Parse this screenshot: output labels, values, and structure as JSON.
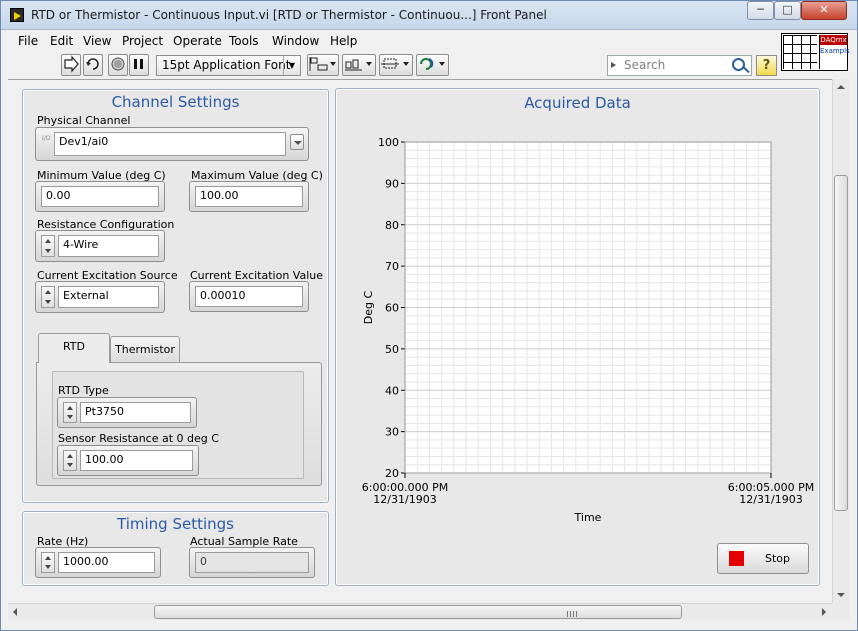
{
  "window": {
    "title": "RTD or Thermistor - Continuous Input.vi [RTD or Thermistor - Continuou...] Front Panel",
    "min_label": "─",
    "max_label": "□",
    "close_label": "✕"
  },
  "menu": [
    "File",
    "Edit",
    "View",
    "Project",
    "Operate",
    "Tools",
    "Window",
    "Help"
  ],
  "toolbar": {
    "font": "15pt Application Font",
    "search_placeholder": "Search",
    "help_label": "?"
  },
  "vi_icon": {
    "line1": "DAQmx",
    "line2": "Exampls"
  },
  "channel_settings": {
    "title": "Channel Settings",
    "physical_channel_label": "Physical Channel",
    "physical_channel_value": "Dev1/ai0",
    "io_glyph": "I/O",
    "min_label": "Minimum Value (deg C)",
    "min_value": "0.00",
    "max_label": "Maximum Value (deg C)",
    "max_value": "100.00",
    "resistance_config_label": "Resistance Configuration",
    "resistance_config_value": "4-Wire",
    "excitation_source_label": "Current Excitation Source",
    "excitation_source_value": "External",
    "excitation_value_label": "Current Excitation Value",
    "excitation_value": "0.00010",
    "tabs": [
      {
        "label": "RTD",
        "active": true
      },
      {
        "label": "Thermistor",
        "active": false
      }
    ],
    "rtd_type_label": "RTD Type",
    "rtd_type_value": "Pt3750",
    "sensor_res_label": "Sensor Resistance at 0 deg C",
    "sensor_res_value": "100.00"
  },
  "timing_settings": {
    "title": "Timing Settings",
    "rate_label": "Rate (Hz)",
    "rate_value": "1000.00",
    "actual_rate_label": "Actual Sample Rate",
    "actual_rate_value": "0"
  },
  "acquired_data": {
    "title": "Acquired Data",
    "stop_label": "Stop"
  },
  "chart_data": {
    "type": "line",
    "title": "Acquired Data",
    "xlabel": "Time",
    "ylabel": "Deg C",
    "ylim": [
      20,
      100
    ],
    "yticks": [
      "100",
      "90",
      "80",
      "70",
      "60",
      "50",
      "40",
      "30",
      "20"
    ],
    "xticks": [
      {
        "time": "6:00:00.000 PM",
        "date": "12/31/1903"
      },
      {
        "time": "6:00:05.000 PM",
        "date": "12/31/1903"
      }
    ],
    "series": [],
    "grid": true
  },
  "colors": {
    "panel_title": "#2b5aa3",
    "stop_indicator": "#e40000",
    "grid_minor": "#e6e6e6",
    "grid_major": "#d0d0d0"
  }
}
